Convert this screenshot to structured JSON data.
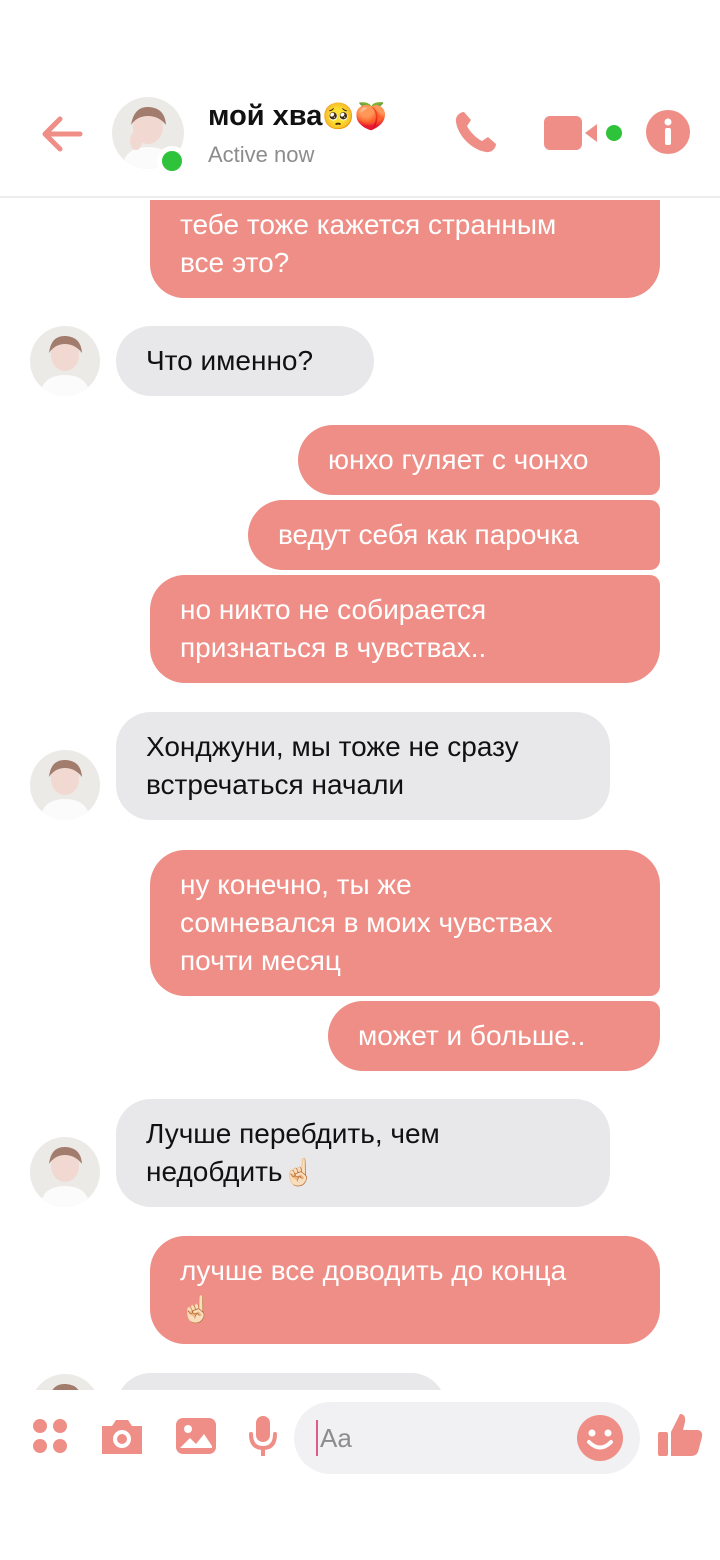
{
  "header": {
    "title": "мой хва",
    "title_emojis": "🥺🍑",
    "status": "Active now"
  },
  "colors": {
    "accent": "#ee8e86",
    "incoming_bubble": "#e8e8ea",
    "online": "#2fc33b"
  },
  "messages": [
    {
      "id": "m1",
      "direction": "out",
      "text": "тебе тоже кажется странным\nвсе это?"
    },
    {
      "id": "m2",
      "direction": "in",
      "text": "Что именно?"
    },
    {
      "id": "m3",
      "direction": "out",
      "text": "юнхо гуляет с чонхо"
    },
    {
      "id": "m4",
      "direction": "out",
      "text": "ведут себя как парочка"
    },
    {
      "id": "m5",
      "direction": "out",
      "text": "но никто не собирается\nпризнаться в чувствах.."
    },
    {
      "id": "m6",
      "direction": "in",
      "text": "Хонджуни, мы тоже не сразу\nвстречаться начали"
    },
    {
      "id": "m7",
      "direction": "out",
      "text": "ну конечно, ты же\nсомневался в моих чувствах\nпочти месяц"
    },
    {
      "id": "m8",
      "direction": "out",
      "text": "может и больше.."
    },
    {
      "id": "m9",
      "direction": "in",
      "text": "Лучше перебдить, чем\nнедобдить",
      "emoji": "☝🏻"
    },
    {
      "id": "m10",
      "direction": "out",
      "text": "лучше все доводить до конца",
      "emoji": "☝🏻"
    }
  ],
  "composer": {
    "placeholder": "Aa",
    "icons": [
      "apps-icon",
      "camera-icon",
      "gallery-icon",
      "microphone-icon",
      "emoji-icon",
      "thumbs-up-icon"
    ]
  }
}
